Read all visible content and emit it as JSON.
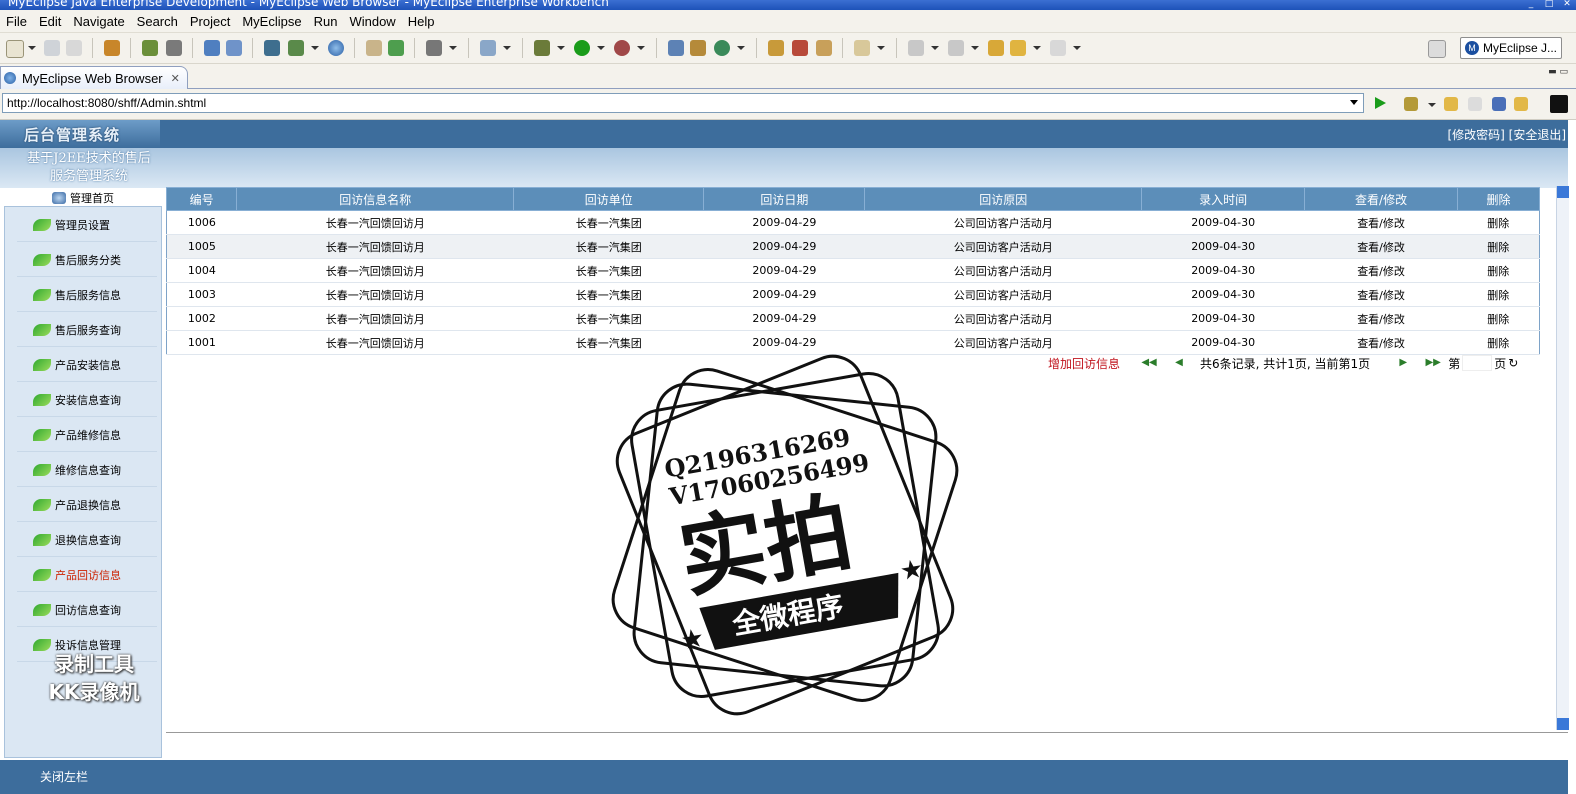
{
  "window": {
    "title": "MyEclipse Java Enterprise Development - MyEclipse Web Browser - MyEclipse Enterprise Workbench"
  },
  "menu": [
    "File",
    "Edit",
    "Navigate",
    "Search",
    "Project",
    "MyEclipse",
    "Run",
    "Window",
    "Help"
  ],
  "perspective": {
    "label": "MyEclipse J..."
  },
  "editor_tab": {
    "label": "MyEclipse Web Browser"
  },
  "browser": {
    "url": "http://localhost:8080/shff/Admin.shtml"
  },
  "app": {
    "logo": "后台管理系统",
    "header_links": "[修改密码] [安全退出]",
    "system_name_line1": "基于J2EE技术的售后",
    "system_name_line2": "服务管理系统",
    "home_label": "管理首页"
  },
  "sidebar": {
    "items": [
      "管理员设置",
      "售后服务分类",
      "售后服务信息",
      "售后服务查询",
      "产品安装信息",
      "安装信息查询",
      "产品维修信息",
      "维修信息查询",
      "产品退换信息",
      "退换信息查询",
      "产品回访信息",
      "回访信息查询",
      "投诉信息管理"
    ],
    "active_index": 10,
    "watermark_line1": "录制工具",
    "watermark_line2": "KK录像机"
  },
  "table": {
    "columns": [
      "编号",
      "回访信息名称",
      "回访单位",
      "回访日期",
      "回访原因",
      "录入时间",
      "查看/修改",
      "删除"
    ],
    "rows": [
      [
        "1006",
        "长春一汽回馈回访月",
        "长春一汽集团",
        "2009-04-29",
        "公司回访客户活动月",
        "2009-04-30",
        "查看/修改",
        "删除"
      ],
      [
        "1005",
        "长春一汽回馈回访月",
        "长春一汽集团",
        "2009-04-29",
        "公司回访客户活动月",
        "2009-04-30",
        "查看/修改",
        "删除"
      ],
      [
        "1004",
        "长春一汽回馈回访月",
        "长春一汽集团",
        "2009-04-29",
        "公司回访客户活动月",
        "2009-04-30",
        "查看/修改",
        "删除"
      ],
      [
        "1003",
        "长春一汽回馈回访月",
        "长春一汽集团",
        "2009-04-29",
        "公司回访客户活动月",
        "2009-04-30",
        "查看/修改",
        "删除"
      ],
      [
        "1002",
        "长春一汽回馈回访月",
        "长春一汽集团",
        "2009-04-29",
        "公司回访客户活动月",
        "2009-04-30",
        "查看/修改",
        "删除"
      ],
      [
        "1001",
        "长春一汽回馈回访月",
        "长春一汽集团",
        "2009-04-29",
        "公司回访客户活动月",
        "2009-04-30",
        "查看/修改",
        "删除"
      ]
    ]
  },
  "pager": {
    "add_label": "增加回访信息",
    "summary": "共6条记录, 共计1页, 当前第1页",
    "goto_prefix": "第",
    "goto_suffix": "页"
  },
  "footer": {
    "close_sidebar": "关闭左栏"
  },
  "stamp": {
    "qq": "Q2196316269",
    "wechat": "V17060256499",
    "main": "实拍",
    "banner": "全微程序"
  },
  "colors": {
    "header_blue": "#3d6d9c",
    "table_header": "#5c8eb9",
    "active_red": "#cc2200"
  }
}
